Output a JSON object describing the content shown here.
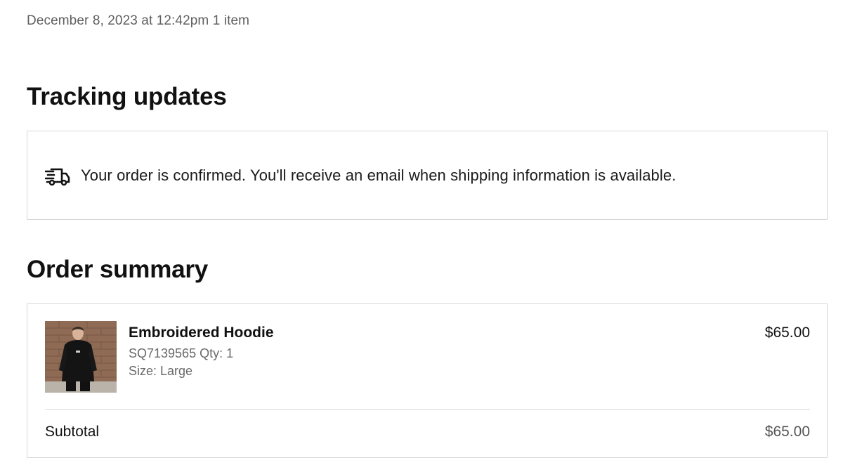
{
  "order": {
    "meta": "December 8, 2023 at 12:42pm 1 item"
  },
  "tracking": {
    "heading": "Tracking updates",
    "icon": "truck-icon",
    "message": "Your order is confirmed. You'll receive an email when shipping information is available."
  },
  "summary": {
    "heading": "Order summary",
    "item": {
      "name": "Embroidered Hoodie",
      "sku_qty": "SQ7139565 Qty: 1",
      "size": "Size: Large",
      "price": "$65.00",
      "image": "product-photo-hoodie"
    },
    "subtotal_label": "Subtotal",
    "subtotal_value": "$65.00"
  },
  "colors": {
    "text": "#111111",
    "muted": "#5f5f5f",
    "border": "#d7d7d7"
  }
}
